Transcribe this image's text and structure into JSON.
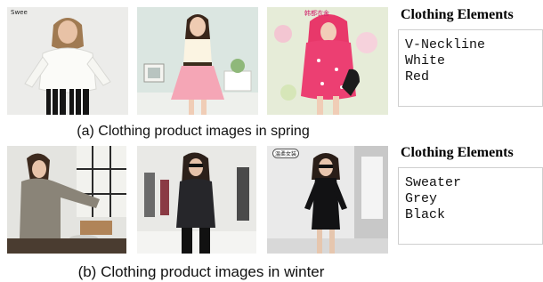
{
  "figure": {
    "rows": [
      {
        "caption": "(a) Clothing product images in spring",
        "elements_title": "Clothing Elements",
        "elements": [
          "V-Neckline",
          "White",
          "Red"
        ],
        "watermarks": [
          "Swee",
          "韩都衣舍"
        ]
      },
      {
        "caption": "(b) Clothing product images in winter",
        "elements_title": "Clothing Elements",
        "elements": [
          "Sweater",
          "Grey",
          "Black"
        ],
        "watermarks": [
          "温柔女装"
        ]
      }
    ]
  },
  "colors": {
    "text": "#111111",
    "panel_border": "#cfcfcf"
  }
}
